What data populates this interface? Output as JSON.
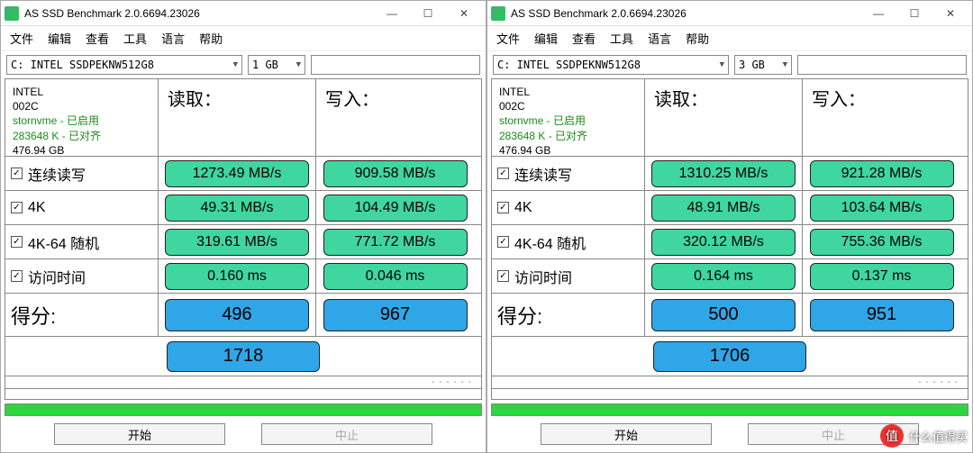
{
  "windows": [
    {
      "title": "AS SSD Benchmark 2.0.6694.23026",
      "menu": [
        "文件",
        "编辑",
        "查看",
        "工具",
        "语言",
        "帮助"
      ],
      "drive": "C: INTEL SSDPEKNW512G8",
      "size": "1 GB",
      "info": {
        "model": "INTEL",
        "fw": "002C",
        "driver": "stornvme - 已启用",
        "align": "283648 K - 已对齐",
        "capacity": "476.94 GB"
      },
      "headers": {
        "read": "读取：",
        "write": "写入："
      },
      "rows": {
        "seq": {
          "label": "连续读写",
          "read": "1273.49 MB/s",
          "write": "909.58 MB/s"
        },
        "k4": {
          "label": "4K",
          "read": "49.31 MB/s",
          "write": "104.49 MB/s"
        },
        "k464": {
          "label": "4K-64 随机",
          "read": "319.61 MB/s",
          "write": "771.72 MB/s"
        },
        "acc": {
          "label": "访问时间",
          "read": "0.160 ms",
          "write": "0.046 ms"
        }
      },
      "score": {
        "label": "得分:",
        "read": "496",
        "write": "967",
        "total": "1718"
      },
      "buttons": {
        "start": "开始",
        "stop": "中止"
      },
      "stop_enabled": false
    },
    {
      "title": "AS SSD Benchmark 2.0.6694.23026",
      "menu": [
        "文件",
        "编辑",
        "查看",
        "工具",
        "语言",
        "帮助"
      ],
      "drive": "C: INTEL SSDPEKNW512G8",
      "size": "3 GB",
      "info": {
        "model": "INTEL",
        "fw": "002C",
        "driver": "stornvme - 已启用",
        "align": "283648 K - 已对齐",
        "capacity": "476.94 GB"
      },
      "headers": {
        "read": "读取：",
        "write": "写入："
      },
      "rows": {
        "seq": {
          "label": "连续读写",
          "read": "1310.25 MB/s",
          "write": "921.28 MB/s"
        },
        "k4": {
          "label": "4K",
          "read": "48.91 MB/s",
          "write": "103.64 MB/s"
        },
        "k464": {
          "label": "4K-64 随机",
          "read": "320.12 MB/s",
          "write": "755.36 MB/s"
        },
        "acc": {
          "label": "访问时间",
          "read": "0.164 ms",
          "write": "0.137 ms"
        }
      },
      "score": {
        "label": "得分:",
        "read": "500",
        "write": "951",
        "total": "1706"
      },
      "buttons": {
        "start": "开始",
        "stop": "中止"
      },
      "stop_enabled": false
    }
  ],
  "watermark": "什么值得买"
}
